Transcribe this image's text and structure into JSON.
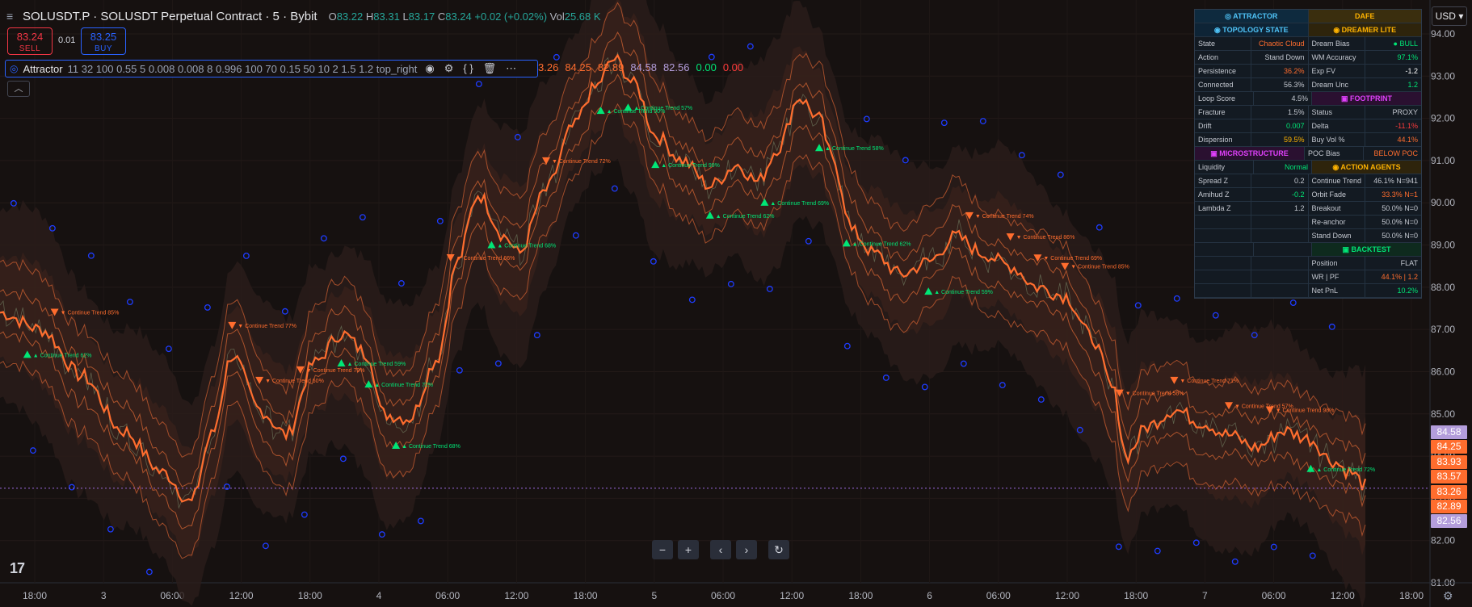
{
  "header": {
    "title": "SOLUSDT.P · SOLUSDT Perpetual Contract · 5 · Bybit",
    "open_label": "O",
    "open": "83.22",
    "high_label": "H",
    "high": "83.31",
    "low_label": "L",
    "low": "83.17",
    "close_label": "C",
    "close": "83.24",
    "change": "+0.02 (+0.02%)",
    "vol_label": "Vol",
    "vol": "25.68 K"
  },
  "trade": {
    "sell_price": "83.24",
    "sell_label": "SELL",
    "spread": "0.01",
    "buy_price": "83.25",
    "buy_label": "BUY"
  },
  "indicator": {
    "name": "Attractor",
    "params": "11 32 100 0.55 5 0.008 0.008 8 0.996 100 70 0.15 50 10 2 1.5 1.2 top_right",
    "values": [
      {
        "text": "3.26",
        "color": "#ff6d2e"
      },
      {
        "text": "84.25",
        "color": "#ff6d2e"
      },
      {
        "text": "82.89",
        "color": "#ff6d2e"
      },
      {
        "text": "84.58",
        "color": "#b39ddb"
      },
      {
        "text": "82.56",
        "color": "#b39ddb"
      },
      {
        "text": "0.00",
        "color": "#00e676"
      },
      {
        "text": "0.00",
        "color": "#ff3b3b"
      }
    ]
  },
  "currency": "USD",
  "price_axis": [
    "94.00",
    "93.00",
    "92.00",
    "91.00",
    "90.00",
    "89.00",
    "88.00",
    "87.00",
    "86.00",
    "85.00",
    "84.00",
    "83.00",
    "82.00",
    "81.00"
  ],
  "time_axis": [
    "18:00",
    "3",
    "06:00",
    "12:00",
    "18:00",
    "4",
    "06:00",
    "12:00",
    "18:00",
    "5",
    "06:00",
    "12:00",
    "18:00",
    "6",
    "06:00",
    "12:00",
    "18:00",
    "7",
    "06:00",
    "12:00",
    "18:00"
  ],
  "price_tags": [
    {
      "text": "84.58",
      "value": 84.58,
      "color": "#b39ddb"
    },
    {
      "text": "84.25",
      "value": 84.25,
      "color": "#ff6d2e"
    },
    {
      "text": "83.93",
      "value": 83.93,
      "color": "#ff6d2e"
    },
    {
      "text": "83.57",
      "value": 83.57,
      "color": "#ff6d2e"
    },
    {
      "text": "83.26",
      "value": 83.26,
      "color": "#ff6d2e"
    },
    {
      "text": "82.89",
      "value": 82.89,
      "color": "#ff6d2e"
    },
    {
      "text": "82.56",
      "value": 82.56,
      "color": "#b39ddb"
    }
  ],
  "signal_label": "Continue Trend",
  "signals": [
    {
      "t": 0.02,
      "dir": "up",
      "pct": "62%"
    },
    {
      "t": 0.04,
      "dir": "dn",
      "pct": "85%"
    },
    {
      "t": 0.17,
      "dir": "dn",
      "pct": "77%"
    },
    {
      "t": 0.19,
      "dir": "dn",
      "pct": "60%"
    },
    {
      "t": 0.22,
      "dir": "dn",
      "pct": "79%"
    },
    {
      "t": 0.25,
      "dir": "up",
      "pct": "59%"
    },
    {
      "t": 0.27,
      "dir": "up",
      "pct": "72%"
    },
    {
      "t": 0.29,
      "dir": "up",
      "pct": "68%"
    },
    {
      "t": 0.33,
      "dir": "dn",
      "pct": "66%"
    },
    {
      "t": 0.36,
      "dir": "up",
      "pct": "68%"
    },
    {
      "t": 0.4,
      "dir": "dn",
      "pct": "72%"
    },
    {
      "t": 0.44,
      "dir": "up",
      "pct": "90%"
    },
    {
      "t": 0.46,
      "dir": "up",
      "pct": "57%"
    },
    {
      "t": 0.48,
      "dir": "up",
      "pct": "99%"
    },
    {
      "t": 0.52,
      "dir": "up",
      "pct": "62%"
    },
    {
      "t": 0.56,
      "dir": "up",
      "pct": "69%"
    },
    {
      "t": 0.6,
      "dir": "up",
      "pct": "58%"
    },
    {
      "t": 0.62,
      "dir": "up",
      "pct": "62%"
    },
    {
      "t": 0.68,
      "dir": "up",
      "pct": "59%"
    },
    {
      "t": 0.71,
      "dir": "dn",
      "pct": "74%"
    },
    {
      "t": 0.74,
      "dir": "dn",
      "pct": "86%"
    },
    {
      "t": 0.76,
      "dir": "dn",
      "pct": "69%"
    },
    {
      "t": 0.78,
      "dir": "dn",
      "pct": "85%"
    },
    {
      "t": 0.82,
      "dir": "dn",
      "pct": "58%"
    },
    {
      "t": 0.86,
      "dir": "dn",
      "pct": "71%"
    },
    {
      "t": 0.9,
      "dir": "dn",
      "pct": "57%"
    },
    {
      "t": 0.93,
      "dir": "dn",
      "pct": "98%"
    },
    {
      "t": 0.96,
      "dir": "up",
      "pct": "72%"
    }
  ],
  "series": {
    "start": 87.4,
    "knots": [
      [
        0.0,
        87.4
      ],
      [
        0.03,
        87.0
      ],
      [
        0.06,
        85.9
      ],
      [
        0.09,
        84.6
      ],
      [
        0.12,
        83.6
      ],
      [
        0.14,
        82.9
      ],
      [
        0.155,
        84.5
      ],
      [
        0.17,
        86.4
      ],
      [
        0.19,
        85.1
      ],
      [
        0.21,
        84.5
      ],
      [
        0.23,
        86.2
      ],
      [
        0.25,
        86.9
      ],
      [
        0.27,
        86.4
      ],
      [
        0.28,
        85.0
      ],
      [
        0.3,
        84.9
      ],
      [
        0.32,
        86.3
      ],
      [
        0.335,
        88.6
      ],
      [
        0.35,
        90.2
      ],
      [
        0.37,
        89.2
      ],
      [
        0.38,
        88.8
      ],
      [
        0.4,
        90.3
      ],
      [
        0.42,
        91.8
      ],
      [
        0.435,
        92.7
      ],
      [
        0.45,
        93.4
      ],
      [
        0.465,
        92.8
      ],
      [
        0.48,
        91.6
      ],
      [
        0.5,
        91.0
      ],
      [
        0.52,
        90.4
      ],
      [
        0.54,
        90.9
      ],
      [
        0.555,
        90.5
      ],
      [
        0.57,
        91.3
      ],
      [
        0.585,
        92.5
      ],
      [
        0.6,
        92.0
      ],
      [
        0.61,
        91.0
      ],
      [
        0.625,
        89.3
      ],
      [
        0.64,
        88.8
      ],
      [
        0.66,
        88.3
      ],
      [
        0.68,
        88.6
      ],
      [
        0.7,
        89.2
      ],
      [
        0.72,
        88.8
      ],
      [
        0.74,
        88.5
      ],
      [
        0.76,
        88.0
      ],
      [
        0.78,
        87.8
      ],
      [
        0.8,
        86.8
      ],
      [
        0.815,
        85.6
      ],
      [
        0.825,
        84.0
      ],
      [
        0.84,
        84.7
      ],
      [
        0.86,
        85.1
      ],
      [
        0.88,
        84.8
      ],
      [
        0.9,
        84.5
      ],
      [
        0.92,
        84.2
      ],
      [
        0.94,
        84.6
      ],
      [
        0.96,
        84.4
      ],
      [
        0.975,
        83.9
      ],
      [
        0.99,
        83.6
      ],
      [
        1.0,
        83.3
      ]
    ]
  },
  "dashboard": {
    "rows": [
      [
        {
          "t": "◎ ATTRACTOR",
          "c": "#4fc3f7",
          "s": 1,
          "bg": "#0e2a3e"
        },
        {
          "t": "",
          "s": 0,
          "bg": "#0e2a3e"
        },
        {
          "t": "DAFE",
          "c": "#ffb300",
          "s": 1,
          "bg": "#3a2e0e"
        },
        {
          "t": "",
          "s": 0,
          "bg": "#3a2e0e"
        }
      ],
      [
        {
          "t": "◉ TOPOLOGY STATE",
          "c": "#4fc3f7",
          "s": 1,
          "bg": "#0e2436"
        },
        {
          "t": "",
          "s": 0,
          "bg": "#0e2436"
        },
        {
          "t": "◉ DREAMER LITE",
          "c": "#ffb300",
          "s": 1,
          "bg": "#2e240c"
        },
        {
          "t": "",
          "s": 0,
          "bg": "#2e240c"
        }
      ],
      [
        {
          "t": "State"
        },
        {
          "t": "Chaotic Cloud",
          "c": "#ff6d2e",
          "r": 1
        },
        {
          "t": "Dream Bias"
        },
        {
          "t": "● BULL",
          "c": "#00e676",
          "r": 1
        }
      ],
      [
        {
          "t": "Action"
        },
        {
          "t": "Stand Down",
          "r": 1
        },
        {
          "t": "WM Accuracy"
        },
        {
          "t": "97.1%",
          "c": "#00e676",
          "r": 1
        }
      ],
      [
        {
          "t": "Persistence"
        },
        {
          "t": "36.2%",
          "c": "#ff6d2e",
          "r": 1
        },
        {
          "t": "Exp FV"
        },
        {
          "t": "-1.2",
          "c": "#ffffff",
          "r": 1
        }
      ],
      [
        {
          "t": "Connected"
        },
        {
          "t": "56.3%",
          "r": 1
        },
        {
          "t": "Dream Unc"
        },
        {
          "t": "1.2",
          "c": "#00e676",
          "r": 1
        }
      ],
      [
        {
          "t": "Loop Score"
        },
        {
          "t": "4.5%",
          "r": 1
        },
        {
          "t": "▣ FOOTPRINT",
          "c": "#e040fb",
          "s": 1,
          "bg": "#2a1030"
        },
        {
          "t": "",
          "s": 0,
          "bg": "#2a1030"
        }
      ],
      [
        {
          "t": "Fracture"
        },
        {
          "t": "1.5%",
          "r": 1
        },
        {
          "t": "Status"
        },
        {
          "t": "PROXY",
          "r": 1
        }
      ],
      [
        {
          "t": "Drift"
        },
        {
          "t": "0.007",
          "c": "#00e676",
          "r": 1
        },
        {
          "t": "Delta"
        },
        {
          "t": "-11.1%",
          "c": "#ff3b3b",
          "r": 1
        }
      ],
      [
        {
          "t": "Dispersion"
        },
        {
          "t": "59.5%",
          "c": "#ffb300",
          "r": 1
        },
        {
          "t": "Buy Vol %"
        },
        {
          "t": "44.1%",
          "c": "#ff6d2e",
          "r": 1
        }
      ],
      [
        {
          "t": "▣ MICROSTRUCTURE",
          "c": "#e040fb",
          "s": 1,
          "bg": "#2a1030"
        },
        {
          "t": "",
          "s": 0,
          "bg": "#2a1030"
        },
        {
          "t": "POC Bias"
        },
        {
          "t": "BELOW POC",
          "c": "#ff6d2e",
          "r": 1
        }
      ],
      [
        {
          "t": "Liquidity"
        },
        {
          "t": "Normal",
          "c": "#00e676",
          "r": 1
        },
        {
          "t": "◉ ACTION AGENTS",
          "c": "#ffb300",
          "s": 1,
          "bg": "#2e240c"
        },
        {
          "t": "",
          "s": 0,
          "bg": "#2e240c"
        }
      ],
      [
        {
          "t": "Spread Z"
        },
        {
          "t": "0.2",
          "r": 1
        },
        {
          "t": "Continue Trend"
        },
        {
          "t": "46.1% N=941",
          "r": 1
        }
      ],
      [
        {
          "t": "Amihud Z"
        },
        {
          "t": "-0.2",
          "c": "#00e676",
          "r": 1
        },
        {
          "t": "Orbit Fade"
        },
        {
          "t": "33.3% N=1",
          "c": "#ff6d2e",
          "r": 1
        }
      ],
      [
        {
          "t": "Lambda Z"
        },
        {
          "t": "1.2",
          "r": 1
        },
        {
          "t": "Breakout"
        },
        {
          "t": "50.0% N=0",
          "r": 1
        }
      ],
      [
        {
          "t": ""
        },
        {
          "t": ""
        },
        {
          "t": "Re-anchor"
        },
        {
          "t": "50.0% N=0",
          "r": 1
        }
      ],
      [
        {
          "t": ""
        },
        {
          "t": ""
        },
        {
          "t": "Stand Down"
        },
        {
          "t": "50.0% N=0",
          "r": 1
        }
      ],
      [
        {
          "t": ""
        },
        {
          "t": ""
        },
        {
          "t": "▣ BACKTEST",
          "c": "#00e676",
          "s": 1,
          "bg": "#0e2a1e"
        },
        {
          "t": "",
          "s": 0,
          "bg": "#0e2a1e"
        }
      ],
      [
        {
          "t": ""
        },
        {
          "t": ""
        },
        {
          "t": "Position"
        },
        {
          "t": "FLAT",
          "r": 1
        }
      ],
      [
        {
          "t": ""
        },
        {
          "t": ""
        },
        {
          "t": "WR | PF"
        },
        {
          "t": "44.1% | 1.2",
          "c": "#ff6d2e",
          "r": 1
        }
      ],
      [
        {
          "t": ""
        },
        {
          "t": ""
        },
        {
          "t": "Net PnL"
        },
        {
          "t": "10.2%",
          "c": "#00e676",
          "r": 1
        }
      ]
    ]
  },
  "nav": {
    "zoom_out": "−",
    "zoom_in": "+",
    "back": "‹",
    "forward": "›",
    "reset": "↻"
  },
  "colors": {
    "price_line": "#ff6d2e",
    "band": "#ff8a50",
    "up": "#00e676",
    "down": "#ff6d2e",
    "circle": "#1e3cff",
    "bg": "#161110"
  }
}
